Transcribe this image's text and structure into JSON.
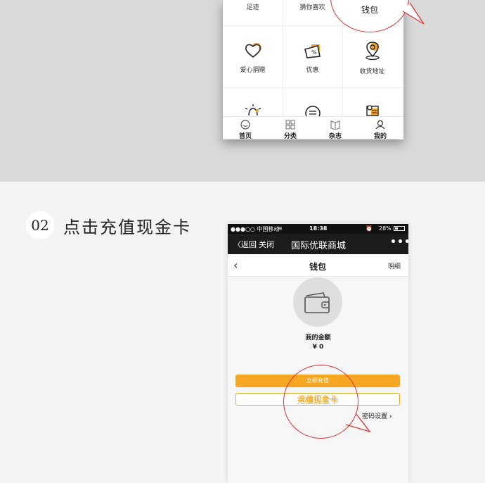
{
  "grid": {
    "row1": [
      "足迹",
      "猜你喜欢"
    ],
    "row2": [
      "爱心捐赠",
      "优惠",
      "收货地址"
    ]
  },
  "callout1": {
    "text": "钱包"
  },
  "tabs": [
    "首页",
    "分类",
    "杂志",
    "我的"
  ],
  "step": {
    "number": "02",
    "title": "点击充值现金卡"
  },
  "phone2": {
    "status": {
      "carrier": "●●●○○ 中国移动",
      "time": "18:38",
      "battery": "28%"
    },
    "nav": {
      "back": "返回",
      "close": "关闭",
      "title": "国际优联商城",
      "more": "•••"
    },
    "header": {
      "title": "钱包",
      "detail": "明细"
    },
    "wallet": {
      "label": "我的金额",
      "amount": "¥ 0"
    },
    "buttons": {
      "recharge": "立即充值",
      "cash_card": "充值现金卡",
      "password": "密码设置"
    }
  },
  "callout2": {
    "text": "充值现金卡"
  },
  "colors": {
    "accent": "#f5a623",
    "callout": "#dd3333"
  }
}
